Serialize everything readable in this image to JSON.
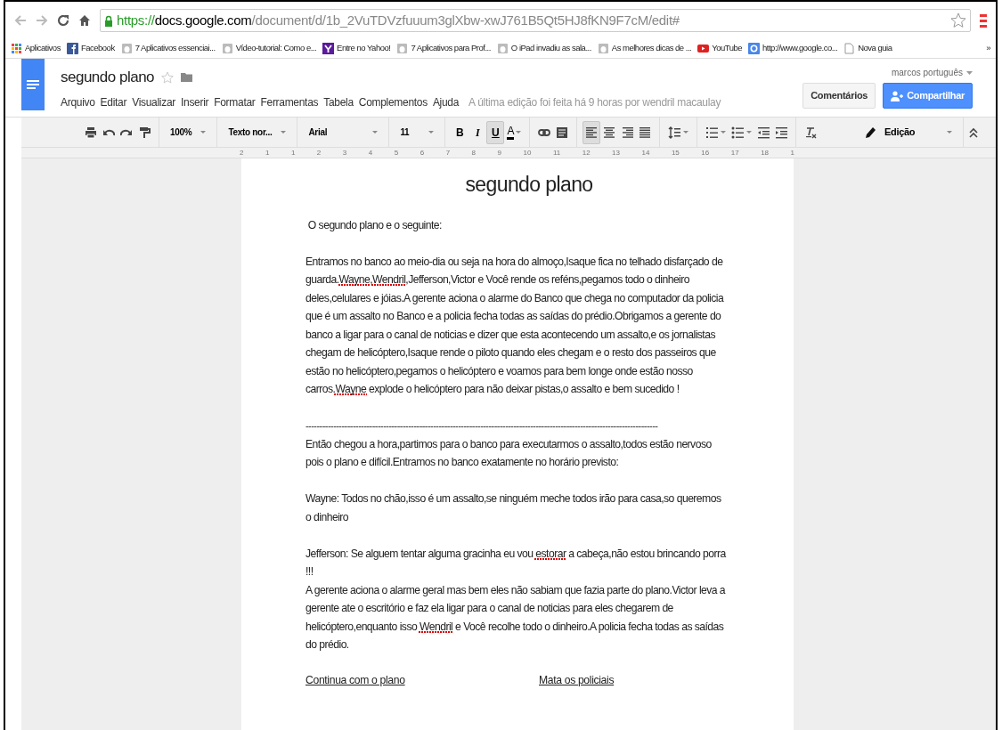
{
  "browser": {
    "url_scheme": "https://",
    "url_host": "docs.google.com",
    "url_path": "/document/d/1b_2VuTDVzfuuum3glXbw-xwJ761B5Qt5HJ8fKN9F7cM/edit#",
    "secure": true,
    "bookmarks": [
      {
        "kind": "apps",
        "label": "Aplicativos"
      },
      {
        "kind": "facebook",
        "label": "Facebook"
      },
      {
        "kind": "page",
        "label": "7 Aplicativos essenciai..."
      },
      {
        "kind": "page",
        "label": "Vídeo-tutorial: Como e..."
      },
      {
        "kind": "yahoo",
        "label": "Entre no Yahoo!"
      },
      {
        "kind": "page",
        "label": "7 Aplicativos para Prof..."
      },
      {
        "kind": "page",
        "label": "O iPad invadiu as sala..."
      },
      {
        "kind": "page",
        "label": "As melhores dicas de ..."
      },
      {
        "kind": "youtube",
        "label": "YouTube"
      },
      {
        "kind": "google",
        "label": "http://www.google.co..."
      },
      {
        "kind": "doc",
        "label": "Nova guia"
      }
    ],
    "more": "»"
  },
  "docs": {
    "title": "segundo plano",
    "user": "marcos português",
    "menu": [
      "Arquivo",
      "Editar",
      "Visualizar",
      "Inserir",
      "Formatar",
      "Ferramentas",
      "Tabela",
      "Complementos",
      "Ajuda"
    ],
    "last_edit": "A última edição foi feita há 9 horas por wendril macaulay",
    "comments_button": "Comentários",
    "share_button": "Compartilhar"
  },
  "toolbar": [
    {
      "kind": "icon",
      "selected": false
    },
    {
      "kind": "icon",
      "selected": false
    },
    {
      "kind": "icon",
      "selected": false
    },
    {
      "kind": "icon",
      "selected": false
    },
    {
      "kind": "sep"
    },
    {
      "kind": "dropdown",
      "label": "100%"
    },
    {
      "kind": "sep"
    },
    {
      "kind": "dropdown",
      "label": "Texto nor..."
    },
    {
      "kind": "sep"
    },
    {
      "kind": "dropdown",
      "label": "Arial"
    },
    {
      "kind": "sep"
    },
    {
      "kind": "dropdown",
      "label": "11"
    },
    {
      "kind": "sep"
    },
    {
      "kind": "letter",
      "label": "B",
      "selected": false
    },
    {
      "kind": "letter",
      "label": "I",
      "selected": false
    },
    {
      "kind": "letter",
      "label": "U",
      "selected": true
    },
    {
      "kind": "color",
      "label": "A",
      "selected": false
    },
    {
      "kind": "sep"
    },
    {
      "kind": "icon",
      "selected": false
    },
    {
      "kind": "icon",
      "selected": false
    },
    {
      "kind": "sep"
    },
    {
      "kind": "icon",
      "selected": true
    },
    {
      "kind": "icon",
      "selected": false
    },
    {
      "kind": "icon",
      "selected": false
    },
    {
      "kind": "icon",
      "selected": false
    },
    {
      "kind": "sep"
    },
    {
      "kind": "icon",
      "selected": false
    },
    {
      "kind": "sep"
    },
    {
      "kind": "icon",
      "selected": false
    },
    {
      "kind": "icon",
      "selected": false
    },
    {
      "kind": "icon",
      "selected": false
    },
    {
      "kind": "icon",
      "selected": false
    },
    {
      "kind": "sep"
    },
    {
      "kind": "icon",
      "selected": false
    }
  ],
  "mode": "Edição",
  "ruler": [
    "2",
    "1",
    "1",
    "2",
    "3",
    "4",
    "5",
    "6",
    "7",
    "8",
    "9",
    "10",
    "11",
    "12",
    "13",
    "14",
    "15",
    "16",
    "17",
    "18",
    "1"
  ],
  "document": {
    "title": "segundo plano",
    "paragraphs": [
      {
        "kind": "text",
        "segments": [
          {
            "text": " O segundo plano e o seguinte:",
            "misspelled": false
          }
        ]
      },
      {
        "kind": "text",
        "segments": [
          {
            "text": "Entramos no banco ao meio-dia ou seja na hora do almoço,Isaque fica no telhado disfarçado de guarda.",
            "misspelled": false
          },
          {
            "text": "Wayne",
            "misspelled": true
          },
          {
            "text": ",",
            "misspelled": false
          },
          {
            "text": "Wendril",
            "misspelled": true
          },
          {
            "text": ",Jefferson,Victor e Você rende os reféns,pegamos todo o dinheiro deles,celulares e jóias.A gerente aciona o alarme do Banco que chega no computador da policia que é um assalto no Banco e a policia fecha todas as saídas do prédio.Obrigamos a gerente do banco a ligar para o canal de noticias e dizer que esta acontecendo um assalto,e os jornalistas chegam de helicóptero,Isaque rende o piloto quando eles chegam e o resto dos passeiros que estão no helicóptero,pegamos o helicóptero e voamos para bem longe onde estão nosso carros.",
            "misspelled": false
          },
          {
            "text": "Wayne",
            "misspelled": true
          },
          {
            "text": " explode o helicóptero para não deixar pistas,o assalto e bem sucedido !",
            "misspelled": false
          }
        ]
      },
      {
        "kind": "rule",
        "text": "-------------------------------------------------------------------------------------------------------------------------------"
      },
      {
        "kind": "continuation",
        "segments": [
          {
            "text": "Então chegou a hora,partimos para o banco para executarmos o assalto,todos estão nervoso pois o plano e difícil.Entramos no banco exatamente no horário previsto:",
            "misspelled": false
          }
        ]
      },
      {
        "kind": "text",
        "segments": [
          {
            "text": "Wayne: Todos no chão,isso é um assalto,se ninguém meche todos irão para casa,so queremos o dinheiro",
            "misspelled": false
          }
        ]
      },
      {
        "kind": "text",
        "segments": [
          {
            "text": "Jefferson: Se alguem tentar alguma gracinha eu vou ",
            "misspelled": false
          },
          {
            "text": "estorar",
            "misspelled": true
          },
          {
            "text": " a cabeça,não estou brincando porra !!!",
            "misspelled": false
          }
        ]
      },
      {
        "kind": "continuation",
        "segments": [
          {
            "text": "A gerente aciona o alarme geral mas bem eles não sabiam que fazia parte do plano.Victor leva a gerente ate o escritório e faz ela ligar para o canal de noticias para eles chegarem de helicóptero,enquanto isso ",
            "misspelled": false
          },
          {
            "text": "Wendril",
            "misspelled": true
          },
          {
            "text": " e Você recolhe todo o dinheiro.A policia fecha todas as saídas do prédio.",
            "misspelled": false
          }
        ]
      },
      {
        "kind": "links",
        "links": [
          "Continua com o plano",
          "Mata os policiais"
        ]
      }
    ]
  }
}
